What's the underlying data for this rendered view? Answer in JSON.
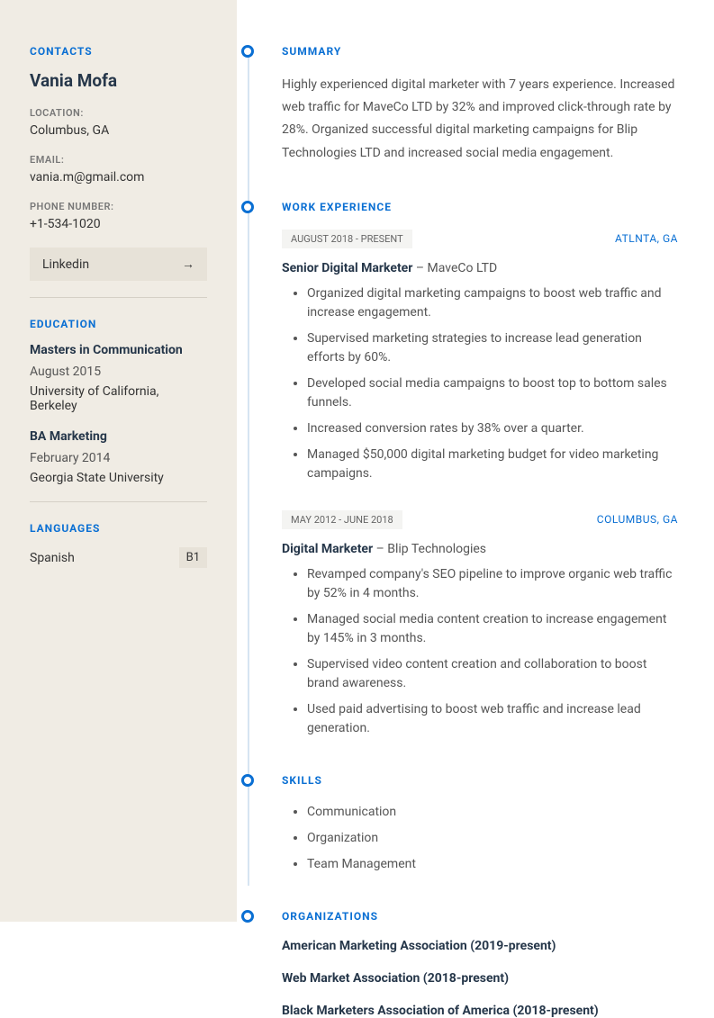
{
  "sidebar": {
    "contacts_heading": "CONTACTS",
    "name": "Vania Mofa",
    "location_label": "LOCATION:",
    "location_value": "Columbus, GA",
    "email_label": "EMAIL:",
    "email_value": "vania.m@gmail.com",
    "phone_label": "PHONE NUMBER:",
    "phone_value": "+1-534-1020",
    "linkedin_label": "Linkedin",
    "education_heading": "EDUCATION",
    "edu": [
      {
        "title": "Masters in Communication",
        "date": "August 2015",
        "school": "University of California, Berkeley"
      },
      {
        "title": "BA Marketing",
        "date": "February 2014",
        "school": "Georgia State University"
      }
    ],
    "languages_heading": "LANGUAGES",
    "lang_name": "Spanish",
    "lang_level": "B1"
  },
  "summary": {
    "heading": "SUMMARY",
    "text": "Highly experienced digital marketer with 7 years experience. Increased web traffic for MaveCo LTD by 32% and improved click-through rate by 28%. Organized successful digital marketing campaigns for Blip Technologies LTD and increased social media engagement."
  },
  "work": {
    "heading": "WORK EXPERIENCE",
    "jobs": [
      {
        "dates": "AUGUST 2018 - PRESENT",
        "location": "ATLNTA, GA",
        "title": "Senior Digital Marketer ",
        "sep": " – ",
        "company": "MaveCo LTD",
        "bullets": [
          "Organized digital marketing campaigns to boost web traffic and increase engagement.",
          "Supervised marketing strategies to increase lead generation efforts by 60%.",
          "Developed social media campaigns to boost top to bottom sales funnels.",
          "Increased conversion rates by 38% over a quarter.",
          "Managed $50,000 digital marketing budget for video marketing campaigns."
        ]
      },
      {
        "dates": "MAY 2012 - JUNE 2018",
        "location": "COLUMBUS, GA",
        "title": "Digital Marketer",
        "sep": " – ",
        "company": "Blip Technologies",
        "bullets": [
          "Revamped company's SEO pipeline to improve organic web traffic by 52% in 4 months.",
          "Managed social media content creation to increase engagement by 145% in 3 months.",
          "Supervised video content creation and collaboration to boost brand awareness.",
          "Used paid advertising to boost web traffic and increase lead generation."
        ]
      }
    ]
  },
  "skills": {
    "heading": "SKILLS",
    "items": [
      "Communication",
      "Organization",
      "Team Management"
    ]
  },
  "orgs": {
    "heading": "ORGANIZATIONS",
    "items": [
      "American Marketing Association (2019-present)",
      "Web Market Association (2018-present)",
      "Black Marketers Association of America (2018-present)"
    ]
  }
}
